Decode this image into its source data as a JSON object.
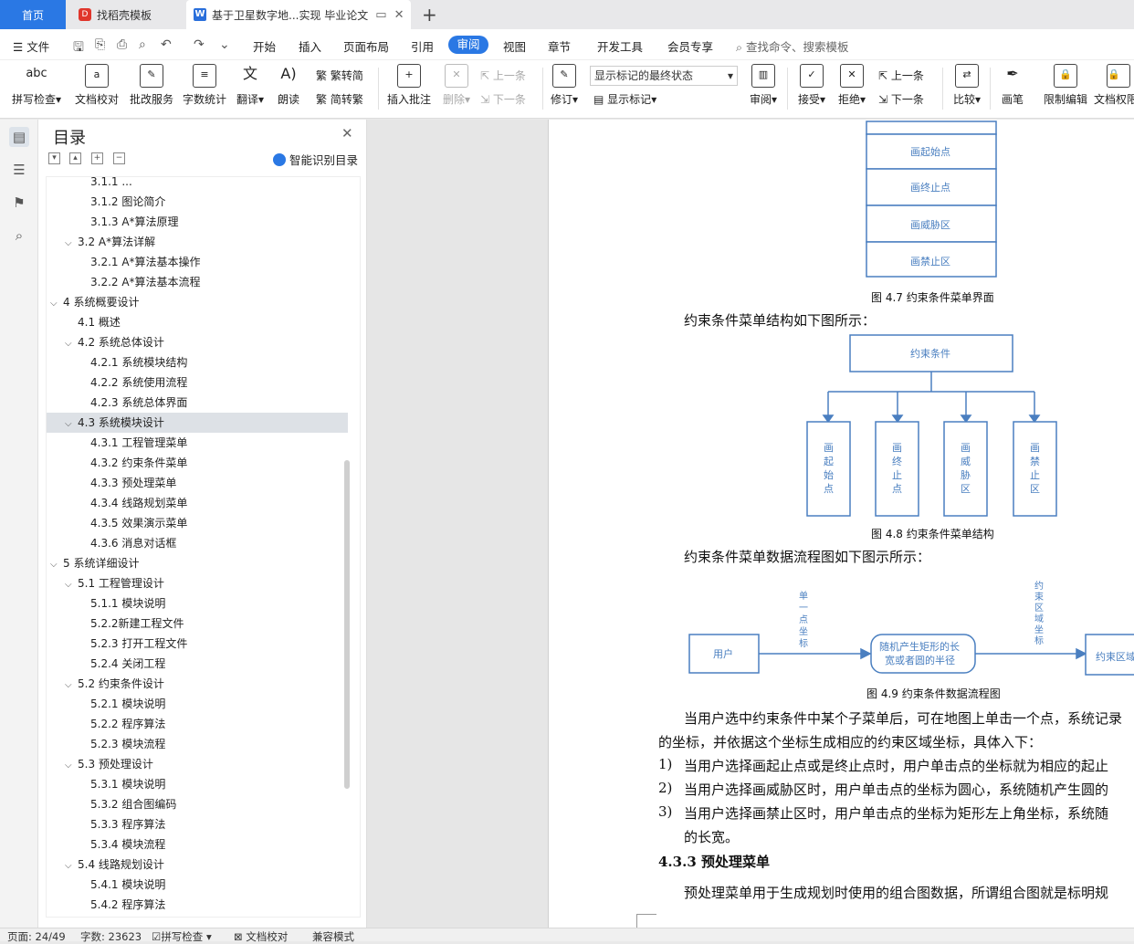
{
  "tabs": {
    "home": "首页",
    "template": "找稻壳模板",
    "document": "基于卫星数字地...实现 毕业论文"
  },
  "menu": {
    "file": "文件",
    "items": [
      "开始",
      "插入",
      "页面布局",
      "引用",
      "审阅",
      "视图",
      "章节",
      "开发工具",
      "会员专享"
    ],
    "active": "审阅",
    "search_placeholder": "查找命令、搜索模板"
  },
  "ribbon": {
    "spellcheck": "拼写检查",
    "doc_check": "文档校对",
    "batch": "批改服务",
    "word_count": "字数统计",
    "translate": "翻译",
    "read_aloud": "朗读",
    "trad_to_simp": "繁转简",
    "simp_to_trad": "简转繁",
    "insert_comment": "插入批注",
    "delete": "删除",
    "prev": "上一条",
    "next": "下一条",
    "track": "修订",
    "markup_state": "显示标记的最终状态",
    "show_markup": "显示标记",
    "review": "审阅",
    "accept": "接受",
    "reject": "拒绝",
    "prev2": "上一条",
    "next2": "下一条",
    "compare": "比较",
    "pen": "画笔",
    "restrict": "限制编辑",
    "permission": "文档权限"
  },
  "toc": {
    "title": "目录",
    "smart": "智能识别目录",
    "items": [
      {
        "text": "3.1.1 ...",
        "level": 3,
        "chev": false
      },
      {
        "text": "3.1.2  图论简介",
        "level": 3,
        "chev": false
      },
      {
        "text": "3.1.3  A*算法原理",
        "level": 3,
        "chev": false
      },
      {
        "text": "3.2  A*算法详解",
        "level": 2,
        "chev": true
      },
      {
        "text": "3.2.1  A*算法基本操作",
        "level": 3,
        "chev": false
      },
      {
        "text": "3.2.2  A*算法基本流程",
        "level": 3,
        "chev": false
      },
      {
        "text": "4  系统概要设计",
        "level": 1,
        "chev": true
      },
      {
        "text": "4.1  概述",
        "level": 2,
        "chev": false
      },
      {
        "text": "4.2  系统总体设计",
        "level": 2,
        "chev": true
      },
      {
        "text": "4.2.1  系统模块结构",
        "level": 3,
        "chev": false
      },
      {
        "text": "4.2.2  系统使用流程",
        "level": 3,
        "chev": false
      },
      {
        "text": "4.2.3  系统总体界面",
        "level": 3,
        "chev": false
      },
      {
        "text": "4.3  系统模块设计",
        "level": 2,
        "chev": true,
        "selected": true
      },
      {
        "text": "4.3.1  工程管理菜单",
        "level": 3,
        "chev": false
      },
      {
        "text": "4.3.2  约束条件菜单",
        "level": 3,
        "chev": false
      },
      {
        "text": "4.3.3  预处理菜单",
        "level": 3,
        "chev": false
      },
      {
        "text": "4.3.4  线路规划菜单",
        "level": 3,
        "chev": false
      },
      {
        "text": "4.3.5  效果演示菜单",
        "level": 3,
        "chev": false
      },
      {
        "text": "4.3.6  消息对话框",
        "level": 3,
        "chev": false
      },
      {
        "text": "5  系统详细设计",
        "level": 1,
        "chev": true
      },
      {
        "text": "5.1  工程管理设计",
        "level": 2,
        "chev": true
      },
      {
        "text": "5.1.1  模块说明",
        "level": 3,
        "chev": false
      },
      {
        "text": "5.2.2新建工程文件",
        "level": 3,
        "chev": false
      },
      {
        "text": "5.2.3  打开工程文件",
        "level": 3,
        "chev": false
      },
      {
        "text": "5.2.4  关闭工程",
        "level": 3,
        "chev": false
      },
      {
        "text": "5.2  约束条件设计",
        "level": 2,
        "chev": true
      },
      {
        "text": "5.2.1  模块说明",
        "level": 3,
        "chev": false
      },
      {
        "text": "5.2.2  程序算法",
        "level": 3,
        "chev": false
      },
      {
        "text": "5.2.3  模块流程",
        "level": 3,
        "chev": false
      },
      {
        "text": "5.3  预处理设计",
        "level": 2,
        "chev": true
      },
      {
        "text": "5.3.1  模块说明",
        "level": 3,
        "chev": false
      },
      {
        "text": "5.3.2  组合图编码",
        "level": 3,
        "chev": false
      },
      {
        "text": "5.3.3  程序算法",
        "level": 3,
        "chev": false
      },
      {
        "text": "5.3.4  模块流程",
        "level": 3,
        "chev": false
      },
      {
        "text": "5.4  线路规划设计",
        "level": 2,
        "chev": true
      },
      {
        "text": "5.4.1  模块说明",
        "level": 3,
        "chev": false
      },
      {
        "text": "5.4.2  程序算法",
        "level": 3,
        "chev": false
      }
    ]
  },
  "doc": {
    "menu_boxes": [
      "画起始点",
      "画终止点",
      "画威胁区",
      "画禁止区"
    ],
    "fig47": "图 4.7  约束条件菜单界面",
    "p1": "约束条件菜单结构如下图所示：",
    "root": "约束条件",
    "children": [
      "画起始点",
      "画终止点",
      "画威胁区",
      "画禁止区"
    ],
    "fig48": "图 4.8  约束条件菜单结构",
    "p2": "约束条件菜单数据流程图如下图示所示：",
    "flow_user": "用户",
    "flow_edge1": "单一点坐标",
    "flow_mid_line1": "随机产生矩形的长",
    "flow_mid_line2": "宽或者圆的半径",
    "flow_edge2": "约束区域坐标",
    "flow_right": "约束区域",
    "fig49": "图 4.9  约束条件数据流程图",
    "p3a": "当用户选中约束条件中某个子菜单后，可在地图上单击一个点，系统记录",
    "p3b": "的坐标，并依据这个坐标生成相应的约束区域坐标，具体入下：",
    "li1_num": "1)",
    "li1": "当用户选择画起止点或是终止点时，用户单击点的坐标就为相应的起止",
    "li2_num": "2)",
    "li2": "当用户选择画威胁区时，用户单击点的坐标为圆心，系统随机产生圆的",
    "li3_num": "3)",
    "li3": "当用户选择画禁止区时，用户单击点的坐标为矩形左上角坐标，系统随",
    "li3b": "的长宽。",
    "heading": "4.3.3  预处理菜单",
    "p4": "预处理菜单用于生成规划时使用的组合图数据，所谓组合图就是标明规"
  },
  "status": {
    "page": "页面: 24/49",
    "words": "字数: 23623",
    "spell": "拼写检查",
    "proof": "文档校对",
    "compat": "兼容模式"
  },
  "colors": {
    "accent": "#2a78e4",
    "diagram": "#4a7fc0"
  }
}
